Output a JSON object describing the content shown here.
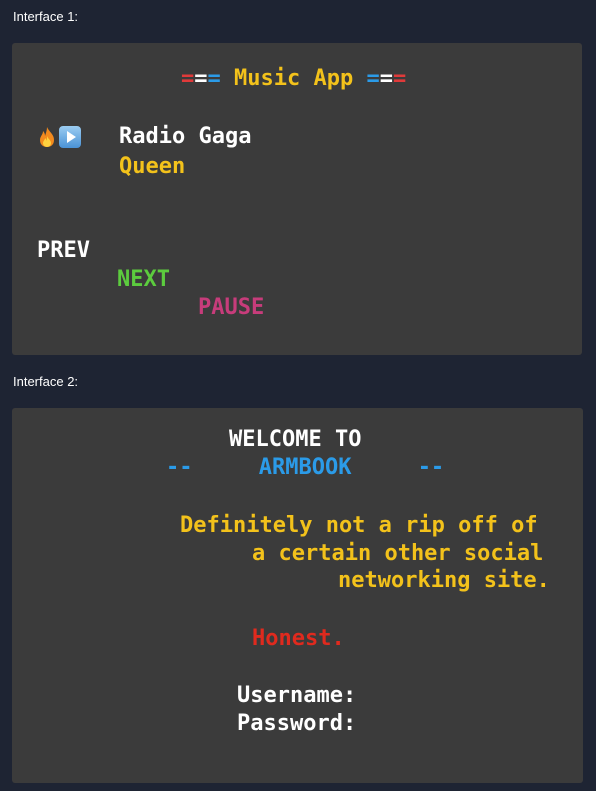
{
  "interface1": {
    "caption": "Interface 1:",
    "title": {
      "left_red": "=",
      "left_white": "=",
      "left_blue": "=",
      "text": " Music App ",
      "right_blue": "=",
      "right_white": "=",
      "right_red": "="
    },
    "icons": [
      "fire-icon",
      "play-icon"
    ],
    "song": "Radio Gaga",
    "artist": "Queen",
    "prev_label": "PREV",
    "next_label": "NEXT",
    "pause_label": "PAUSE",
    "colors": {
      "background": "#3b3b3b",
      "title": "#f3c21b",
      "artist": "#f3c21b",
      "next": "#5ccc3e",
      "pause": "#c73c7b"
    }
  },
  "interface2": {
    "caption": "Interface 2:",
    "welcome": "WELCOME TO",
    "dash_left": "--",
    "brand": "ARMBOOK",
    "dash_right": "--",
    "tagline": [
      "Definitely not a rip off of",
      "a certain other social",
      "networking site."
    ],
    "honest": "Honest.",
    "username_label": "Username:",
    "password_label": "Password:",
    "colors": {
      "background": "#3b3b3b",
      "brand": "#2b9be8",
      "tagline": "#f3c21b",
      "honest": "#e02a1e"
    }
  },
  "page_background": "#1e2433"
}
